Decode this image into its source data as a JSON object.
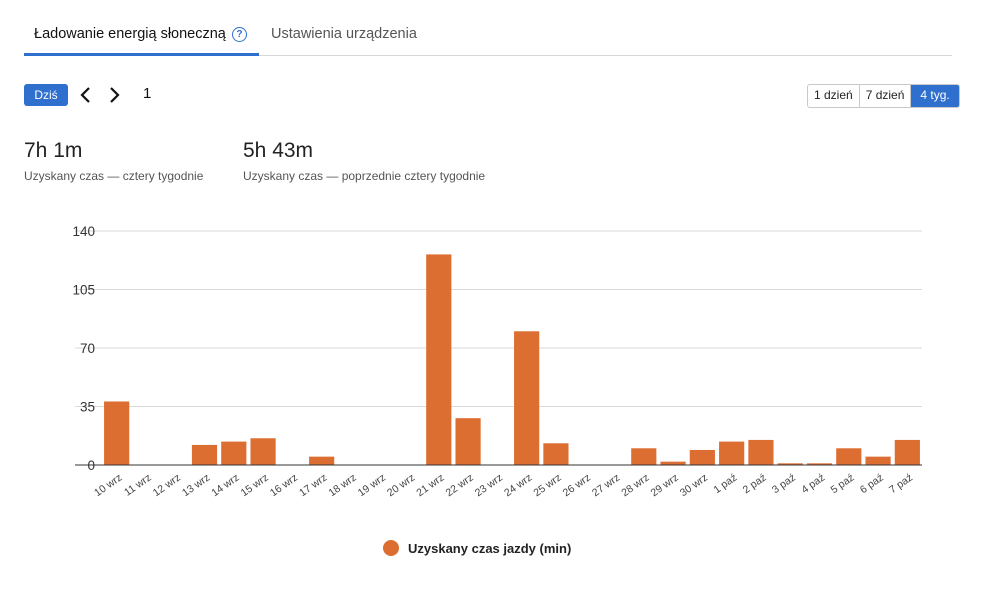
{
  "tabs": {
    "active_label": "Ładowanie energią słoneczną",
    "help_icon": "question-circle-icon",
    "inactive_label": "Ustawienia urządzenia"
  },
  "toolbar": {
    "today_label": "Dziś",
    "prev_icon": "chevron-left-icon",
    "next_icon": "chevron-right-icon",
    "page_number": "1",
    "ranges": [
      "1 dzień",
      "7 dzień",
      "4 tyg."
    ],
    "selected_range": "4 tyg."
  },
  "stats": [
    {
      "value": "7h 1m",
      "label": "Uzyskany czas — cztery tygodnie"
    },
    {
      "value": "5h 43m",
      "label": "Uzyskany czas — poprzednie cztery tygodnie"
    }
  ],
  "colors": {
    "accent": "#2f6fce",
    "bar": "#dd6e32"
  },
  "chart_data": {
    "type": "bar",
    "categories": [
      "10 wrz",
      "11 wrz",
      "12 wrz",
      "13 wrz",
      "14 wrz",
      "15 wrz",
      "16 wrz",
      "17 wrz",
      "18 wrz",
      "19 wrz",
      "20 wrz",
      "21 wrz",
      "22 wrz",
      "23 wrz",
      "24 wrz",
      "25 wrz",
      "26 wrz",
      "27 wrz",
      "28 wrz",
      "29 wrz",
      "30 wrz",
      "1 paź",
      "2 paź",
      "3 paź",
      "4 paź",
      "5 paź",
      "6 paź",
      "7 paź"
    ],
    "series": [
      {
        "name": "Uzyskany czas jazdy (min)",
        "values": [
          38,
          0,
          0,
          12,
          14,
          16,
          0,
          5,
          0,
          0,
          0,
          126,
          28,
          0,
          80,
          13,
          0,
          0,
          10,
          2,
          9,
          14,
          15,
          1,
          1,
          10,
          5,
          15
        ]
      }
    ],
    "yticks": [
      0,
      35,
      70,
      105,
      140
    ],
    "ylim": [
      0,
      140
    ],
    "grid": true,
    "legend_position": "bottom"
  }
}
